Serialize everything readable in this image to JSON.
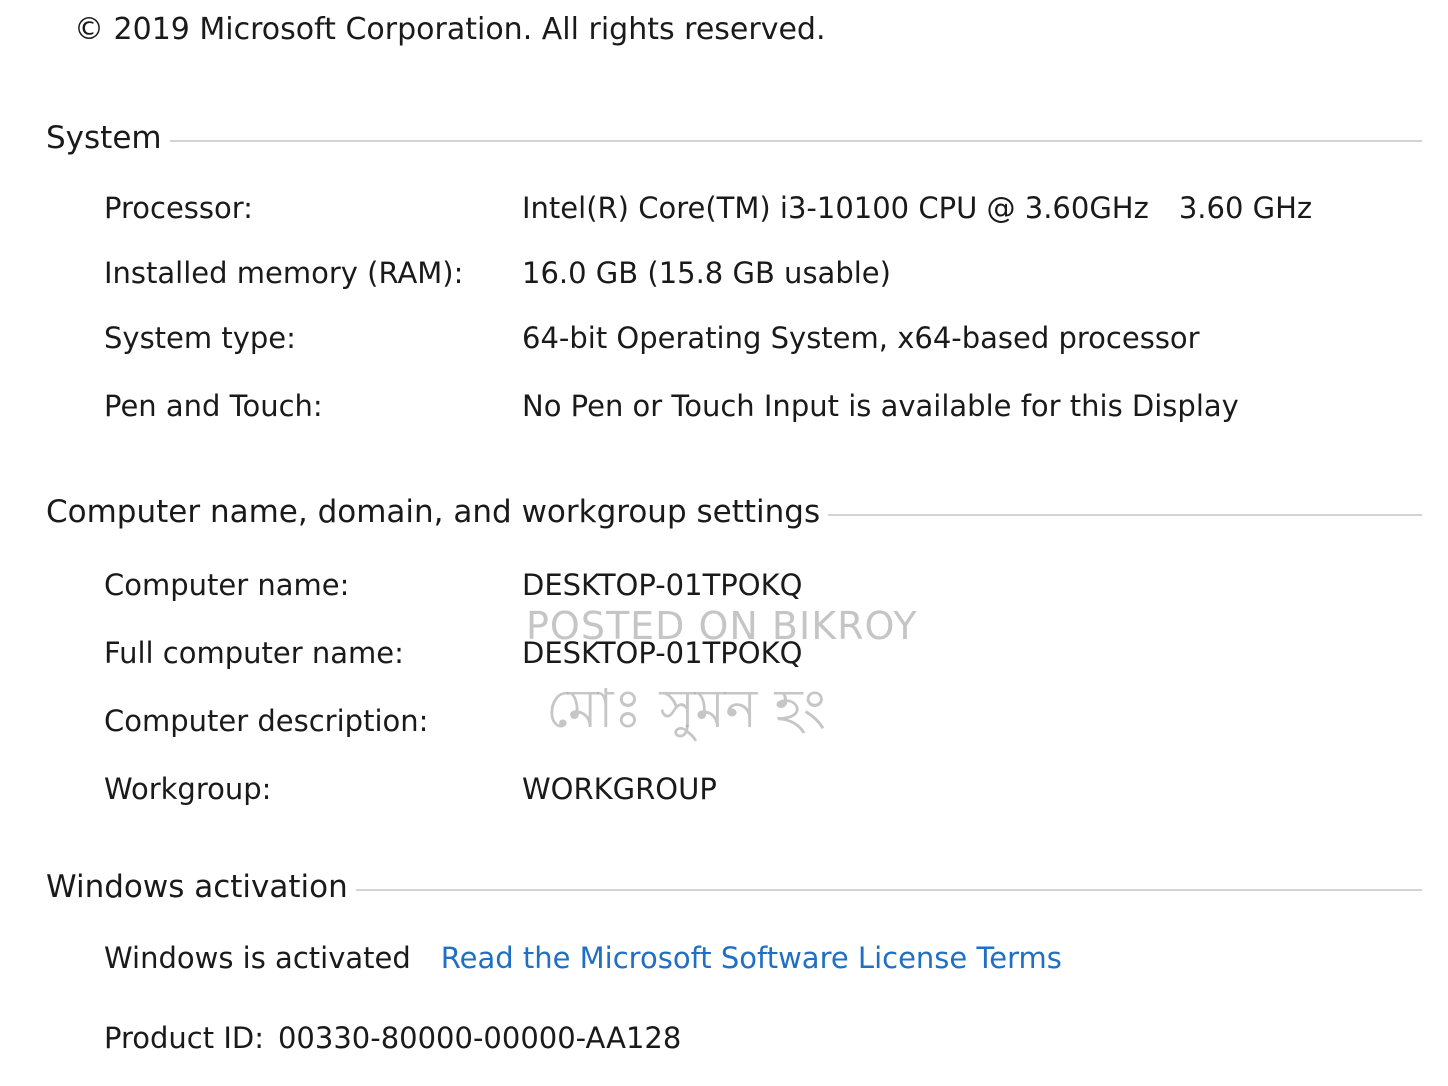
{
  "copyright": "© 2019 Microsoft Corporation. All rights reserved.",
  "system": {
    "title": "System",
    "processor_label": "Processor:",
    "processor_value": "Intel(R) Core(TM) i3-10100 CPU @ 3.60GHz",
    "processor_speed": "3.60 GHz",
    "ram_label": "Installed memory (RAM):",
    "ram_value": "16.0 GB (15.8 GB usable)",
    "type_label": "System type:",
    "type_value": "64-bit Operating System, x64-based processor",
    "pen_label": "Pen and Touch:",
    "pen_value": "No Pen or Touch Input is available for this Display"
  },
  "computer": {
    "title": "Computer name, domain, and workgroup settings",
    "name_label": "Computer name:",
    "name_value": "DESKTOP-01TPOKQ",
    "full_name_label": "Full computer name:",
    "full_name_value": "DESKTOP-01TPOKQ",
    "description_label": "Computer description:",
    "description_value": "",
    "workgroup_label": "Workgroup:",
    "workgroup_value": "WORKGROUP"
  },
  "activation": {
    "title": "Windows activation",
    "status": "Windows is activated",
    "license_link": "Read the Microsoft Software License Terms",
    "product_id_label": "Product ID:",
    "product_id_value": "00330-80000-00000-AA128"
  },
  "watermark": {
    "english": "POSTED ON BIKROY",
    "bengali": "মোঃ সুমন হং"
  },
  "colors": {
    "link": "#1f6fc4",
    "rule": "#d4d4d4",
    "text": "#1a1a1a"
  }
}
